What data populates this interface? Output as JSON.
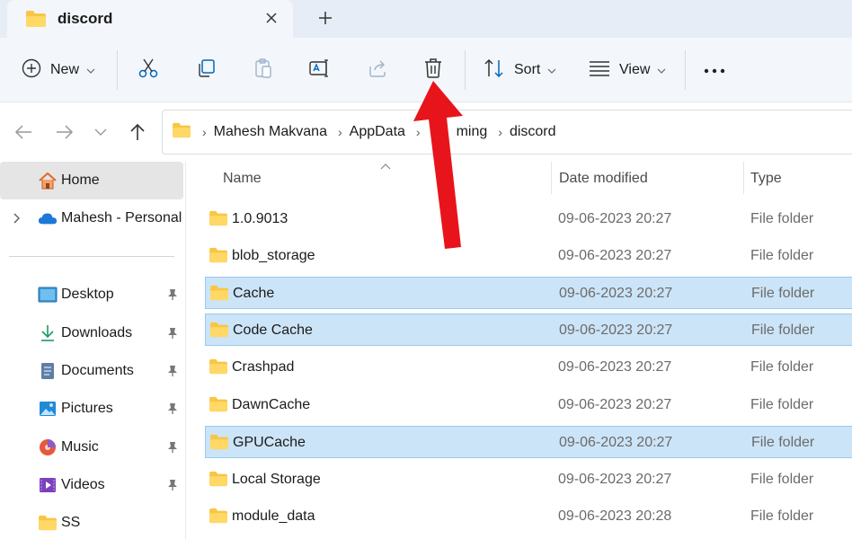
{
  "window": {
    "tab_title": "discord",
    "tab_icon": "folder-icon",
    "close_icon": "close-icon",
    "new_tab_icon": "plus-icon"
  },
  "command_bar": {
    "new_label": "New",
    "sort_label": "Sort",
    "view_label": "View",
    "icons": [
      "new-icon",
      "cut-icon",
      "copy-icon",
      "paste-icon",
      "rename-icon",
      "share-icon",
      "delete-icon",
      "sort-icon",
      "view-icon",
      "more-icon"
    ]
  },
  "navigation": {
    "breadcrumbs": [
      "Mahesh Makvana",
      "AppData",
      "Roaming",
      "discord"
    ],
    "visible_breadcrumbs": [
      "Mahesh Makvana",
      "AppData",
      "ming",
      "discord"
    ]
  },
  "sidebar": {
    "items": [
      {
        "label": "Home",
        "icon": "home-icon"
      },
      {
        "label": "Mahesh - Personal",
        "icon": "cloud-icon"
      },
      {
        "label": "Desktop",
        "icon": "desktop-icon",
        "pinned": true
      },
      {
        "label": "Downloads",
        "icon": "download-icon",
        "pinned": true
      },
      {
        "label": "Documents",
        "icon": "documents-icon",
        "pinned": true
      },
      {
        "label": "Pictures",
        "icon": "pictures-icon",
        "pinned": true
      },
      {
        "label": "Music",
        "icon": "music-icon",
        "pinned": true
      },
      {
        "label": "Videos",
        "icon": "videos-icon",
        "pinned": true
      },
      {
        "label": "SS",
        "icon": "folder-icon",
        "pinned": false
      }
    ]
  },
  "file_list": {
    "columns": {
      "name": "Name",
      "date": "Date modified",
      "type": "Type"
    },
    "rows": [
      {
        "name": "1.0.9013",
        "date": "09-06-2023 20:27",
        "type": "File folder",
        "selected": false
      },
      {
        "name": "blob_storage",
        "date": "09-06-2023 20:27",
        "type": "File folder",
        "selected": false
      },
      {
        "name": "Cache",
        "date": "09-06-2023 20:27",
        "type": "File folder",
        "selected": true
      },
      {
        "name": "Code Cache",
        "date": "09-06-2023 20:27",
        "type": "File folder",
        "selected": true
      },
      {
        "name": "Crashpad",
        "date": "09-06-2023 20:27",
        "type": "File folder",
        "selected": false
      },
      {
        "name": "DawnCache",
        "date": "09-06-2023 20:27",
        "type": "File folder",
        "selected": false
      },
      {
        "name": "GPUCache",
        "date": "09-06-2023 20:27",
        "type": "File folder",
        "selected": true
      },
      {
        "name": "Local Storage",
        "date": "09-06-2023 20:27",
        "type": "File folder",
        "selected": false
      },
      {
        "name": "module_data",
        "date": "09-06-2023 20:28",
        "type": "File folder",
        "selected": false
      }
    ]
  },
  "colors": {
    "accent": "#0067c0",
    "selection": "#cce4f7",
    "selection_border": "#99c9ef",
    "annotation": "#e8141b",
    "folder": "#f8c644"
  }
}
